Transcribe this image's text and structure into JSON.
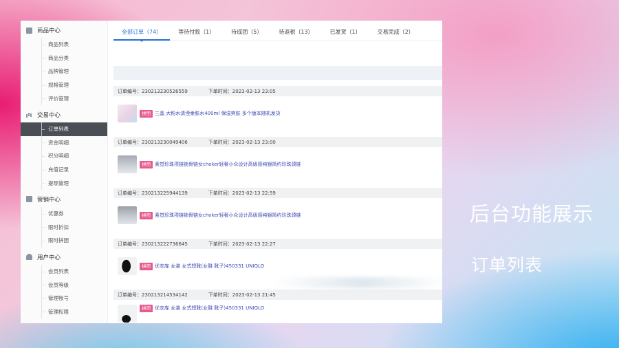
{
  "sidebar": {
    "groups": [
      {
        "icon": "goods-icon",
        "label": "商品中心",
        "items": [
          "商品列表",
          "商品分类",
          "品牌管理",
          "规格管理",
          "评价管理"
        ]
      },
      {
        "icon": "chart-icon",
        "label": "交易中心",
        "items": [
          "订单列表",
          "资金明细",
          "积分明细",
          "充值记录",
          "提现管理"
        ]
      },
      {
        "icon": "marketing-icon",
        "label": "营销中心",
        "items": [
          "优惠券",
          "限时折扣",
          "限时拼团"
        ]
      },
      {
        "icon": "user-icon",
        "label": "用户中心",
        "items": [
          "会员列表",
          "会员等级",
          "管理帐号",
          "管理权限"
        ]
      }
    ],
    "active_item": "订单列表"
  },
  "tabs": [
    {
      "label": "全部订单（74）",
      "active": true
    },
    {
      "label": "等待付款（1）",
      "active": false
    },
    {
      "label": "待成团（5）",
      "active": false
    },
    {
      "label": "待返税（13）",
      "active": false
    },
    {
      "label": "已发货（1）",
      "active": false
    },
    {
      "label": "交易完成（2）",
      "active": false
    }
  ],
  "orders": [
    {
      "order_no_label": "订单编号：230213230526559",
      "time_label": "下单时间：2023-02-13 23:05",
      "tag": "拼团",
      "title": "三晶 大粉水清滢柔肤水400ml 保湿爽肤 多个版本随机发货"
    },
    {
      "order_no_label": "订单编号：230213230049406",
      "time_label": "下单时间：2023-02-13 23:00",
      "tag": "拼团",
      "title": "素觉珍珠项链锁骨链女choker轻奢小众设计高级感纯银简约珍珠颈链"
    },
    {
      "order_no_label": "订单编号：230213225944139",
      "time_label": "下单时间：2023-02-13 22:59",
      "tag": "拼团",
      "title": "素觉珍珠项链锁骨链女choker轻奢小众设计高级感纯银简约珍珠颈链"
    },
    {
      "order_no_label": "订单编号：230213222736645",
      "time_label": "下单时间：2023-02-13 22:27",
      "tag": "拼团",
      "title": "优衣库 女装 女式短靴(女鞋 靴子)450331 UNIQLO"
    },
    {
      "order_no_label": "订单编号：230213214534142",
      "time_label": "下单时间：2023-02-13 21:45",
      "tag": "拼团",
      "title": "优衣库 女装 女式短靴(女鞋 靴子)450331 UNIQLO"
    }
  ],
  "overlay": {
    "title": "后台功能展示",
    "subtitle": "订单列表"
  },
  "colors": {
    "accent": "#2b72d8",
    "tag": "#e85a8c",
    "active_nav": "#4a4e55"
  }
}
